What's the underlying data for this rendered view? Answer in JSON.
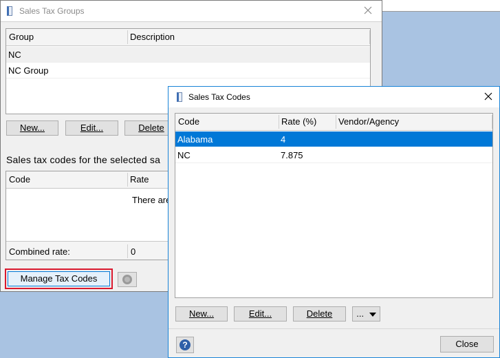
{
  "groups_window": {
    "title": "Sales Tax Groups",
    "columns": [
      "Group",
      "Description"
    ],
    "rows": [
      {
        "group": "NC",
        "description": ""
      },
      {
        "group": "NC Group",
        "description": ""
      }
    ],
    "buttons": {
      "new": "New...",
      "edit": "Edit...",
      "delete": "Delete"
    },
    "codes_section_label": "Sales tax codes for the selected sa",
    "codes_columns": [
      "Code",
      "Rate"
    ],
    "empty_message": "There are",
    "combined_rate_label": "Combined rate:",
    "combined_rate_value": "0",
    "manage_button": "Manage Tax Codes"
  },
  "codes_window": {
    "title": "Sales Tax Codes",
    "columns": [
      "Code",
      "Rate (%)",
      "Vendor/Agency"
    ],
    "rows": [
      {
        "code": "Alabama",
        "rate": "4",
        "vendor": "",
        "selected": true
      },
      {
        "code": "NC",
        "rate": "7.875",
        "vendor": "",
        "selected": false
      }
    ],
    "buttons": {
      "new": "New...",
      "edit": "Edit...",
      "delete": "Delete",
      "more": "..."
    },
    "close_button": "Close"
  },
  "colors": {
    "selection": "#0078d7",
    "highlight_border": "#d9182d",
    "desktop": "#a9c3e2"
  }
}
